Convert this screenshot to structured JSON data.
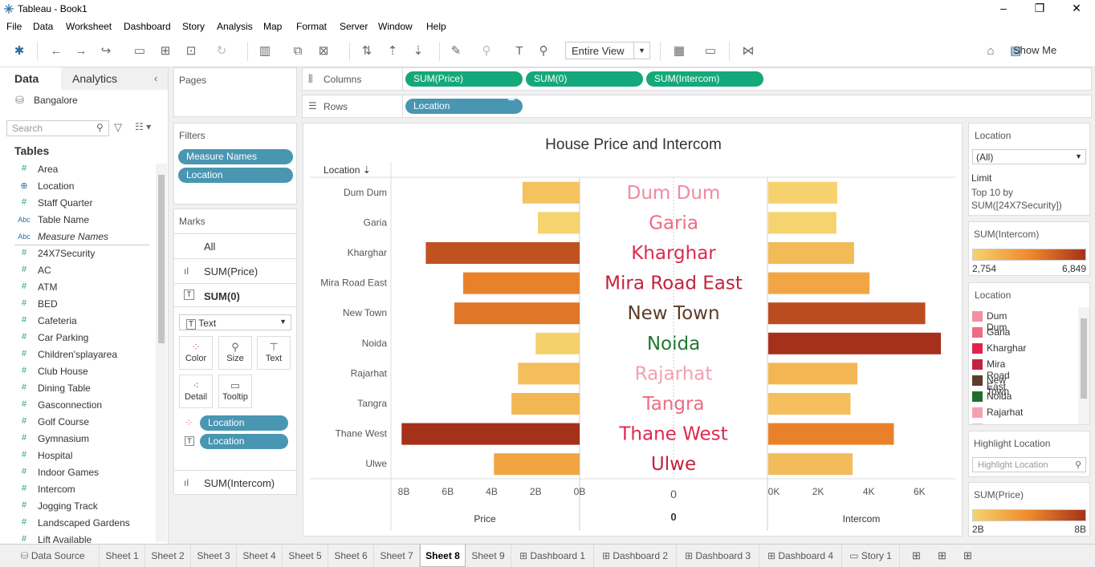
{
  "window": {
    "title": "Tableau - Book1"
  },
  "menu": [
    "File",
    "Data",
    "Worksheet",
    "Dashboard",
    "Story",
    "Analysis",
    "Map",
    "Format",
    "Server",
    "Window",
    "Help"
  ],
  "toolbar": {
    "fit": "Entire View",
    "show_me": "Show Me"
  },
  "left": {
    "tab_data": "Data",
    "tab_analytics": "Analytics",
    "datasource": "Bangalore",
    "search_placeholder": "Search",
    "tables_header": "Tables",
    "fields": [
      {
        "icon": "#",
        "name": "Area",
        "type": "num"
      },
      {
        "icon": "⊕",
        "name": "Location",
        "type": "geo"
      },
      {
        "icon": "#",
        "name": "Staff Quarter",
        "type": "num"
      },
      {
        "icon": "Abc",
        "name": "Table Name",
        "type": "str"
      },
      {
        "icon": "Abc",
        "name": "Measure Names",
        "type": "str-italic"
      },
      {
        "icon": "#",
        "name": "24X7Security",
        "type": "num"
      },
      {
        "icon": "#",
        "name": "AC",
        "type": "num"
      },
      {
        "icon": "#",
        "name": "ATM",
        "type": "num"
      },
      {
        "icon": "#",
        "name": "BED",
        "type": "num"
      },
      {
        "icon": "#",
        "name": "Cafeteria",
        "type": "num"
      },
      {
        "icon": "#",
        "name": "Car Parking",
        "type": "num"
      },
      {
        "icon": "#",
        "name": "Children'splayarea",
        "type": "num"
      },
      {
        "icon": "#",
        "name": "Club House",
        "type": "num"
      },
      {
        "icon": "#",
        "name": "Dining Table",
        "type": "num"
      },
      {
        "icon": "#",
        "name": "Gasconnection",
        "type": "num"
      },
      {
        "icon": "#",
        "name": "Golf Course",
        "type": "num"
      },
      {
        "icon": "#",
        "name": "Gymnasium",
        "type": "num"
      },
      {
        "icon": "#",
        "name": "Hospital",
        "type": "num"
      },
      {
        "icon": "#",
        "name": "Indoor Games",
        "type": "num"
      },
      {
        "icon": "#",
        "name": "Intercom",
        "type": "num"
      },
      {
        "icon": "#",
        "name": "Jogging Track",
        "type": "num"
      },
      {
        "icon": "#",
        "name": "Landscaped Gardens",
        "type": "num"
      },
      {
        "icon": "#",
        "name": "Lift Available",
        "type": "num"
      }
    ]
  },
  "pages": {
    "label": "Pages"
  },
  "filters": {
    "label": "Filters",
    "items": [
      "Measure Names",
      "Location"
    ]
  },
  "marks": {
    "label": "Marks",
    "all": "All",
    "sum_price": "SUM(Price)",
    "sum_0": "SUM(0)",
    "type": "Text",
    "color": "Color",
    "size": "Size",
    "text": "Text",
    "detail": "Detail",
    "tooltip": "Tooltip",
    "pill1": "Location",
    "pill2": "Location",
    "sum_intercom": "SUM(Intercom)"
  },
  "shelves": {
    "columns_label": "Columns",
    "rows_label": "Rows",
    "columns": [
      "SUM(Price)",
      "SUM(0)",
      "SUM(Intercom)"
    ],
    "rows": [
      "Location"
    ]
  },
  "chart_data": {
    "type": "bar",
    "title": "House Price and Intercom",
    "row_header": "Location",
    "categories": [
      "Dum Dum",
      "Garia",
      "Kharghar",
      "Mira Road East",
      "New Town",
      "Noida",
      "Rajarhat",
      "Tangra",
      "Thane West",
      "Ulwe"
    ],
    "series": [
      {
        "name": "Price",
        "values": [
          2.6,
          1.9,
          7.0,
          5.3,
          5.7,
          2.0,
          2.8,
          3.1,
          8.1,
          3.9
        ],
        "xlabel": "Price",
        "ticks": [
          "8B",
          "6B",
          "4B",
          "2B",
          "0B"
        ],
        "xlim": [
          8.5,
          0
        ]
      },
      {
        "name": "0",
        "values": [
          0,
          0,
          0,
          0,
          0,
          0,
          0,
          0,
          0,
          0
        ],
        "xlabel": "0",
        "ticks": [
          "0"
        ]
      },
      {
        "name": "Intercom",
        "values": [
          2754,
          2720,
          3420,
          4030,
          6230,
          6849,
          3550,
          3280,
          4990,
          3360
        ],
        "xlabel": "Intercom",
        "ticks": [
          "0K",
          "2K",
          "4K",
          "6K"
        ],
        "xlim": [
          0,
          7100
        ]
      }
    ],
    "label_colors": [
      "#f08aa0",
      "#ee6b85",
      "#dc2a4f",
      "#c4223c",
      "#5b3d28",
      "#1f7a30",
      "#f4a0b0",
      "#ee6b85",
      "#dc2a4f",
      "#c4223c"
    ]
  },
  "right": {
    "filter_title": "Location",
    "filter_value": "(All)",
    "limit_label": "Limit",
    "limit_desc": "Top 10 by SUM([24X7Security])",
    "intercom_title": "SUM(Intercom)",
    "intercom_min": "2,754",
    "intercom_max": "6,849",
    "legend_title": "Location",
    "legend": [
      {
        "name": "Dum Dum",
        "color": "#f28fa3"
      },
      {
        "name": "Garia",
        "color": "#ee6b85"
      },
      {
        "name": "Kharghar",
        "color": "#e0244b"
      },
      {
        "name": "Mira Road East",
        "color": "#c4223c"
      },
      {
        "name": "New Town",
        "color": "#5b3d28"
      },
      {
        "name": "Noida",
        "color": "#1f6e2e"
      },
      {
        "name": "Rajarhat",
        "color": "#f4a0b0"
      }
    ],
    "highlight_title": "Highlight Location",
    "highlight_placeholder": "Highlight Location",
    "price_title": "SUM(Price)",
    "price_min": "2B",
    "price_max": "8B"
  },
  "sheets": [
    "Data Source",
    "Sheet 1",
    "Sheet 2",
    "Sheet 3",
    "Sheet 4",
    "Sheet 5",
    "Sheet 6",
    "Sheet 7",
    "Sheet 8",
    "Sheet 9",
    "Dashboard 1",
    "Dashboard 2",
    "Dashboard 3",
    "Dashboard 4",
    "Story 1"
  ],
  "active_sheet": "Sheet 8"
}
